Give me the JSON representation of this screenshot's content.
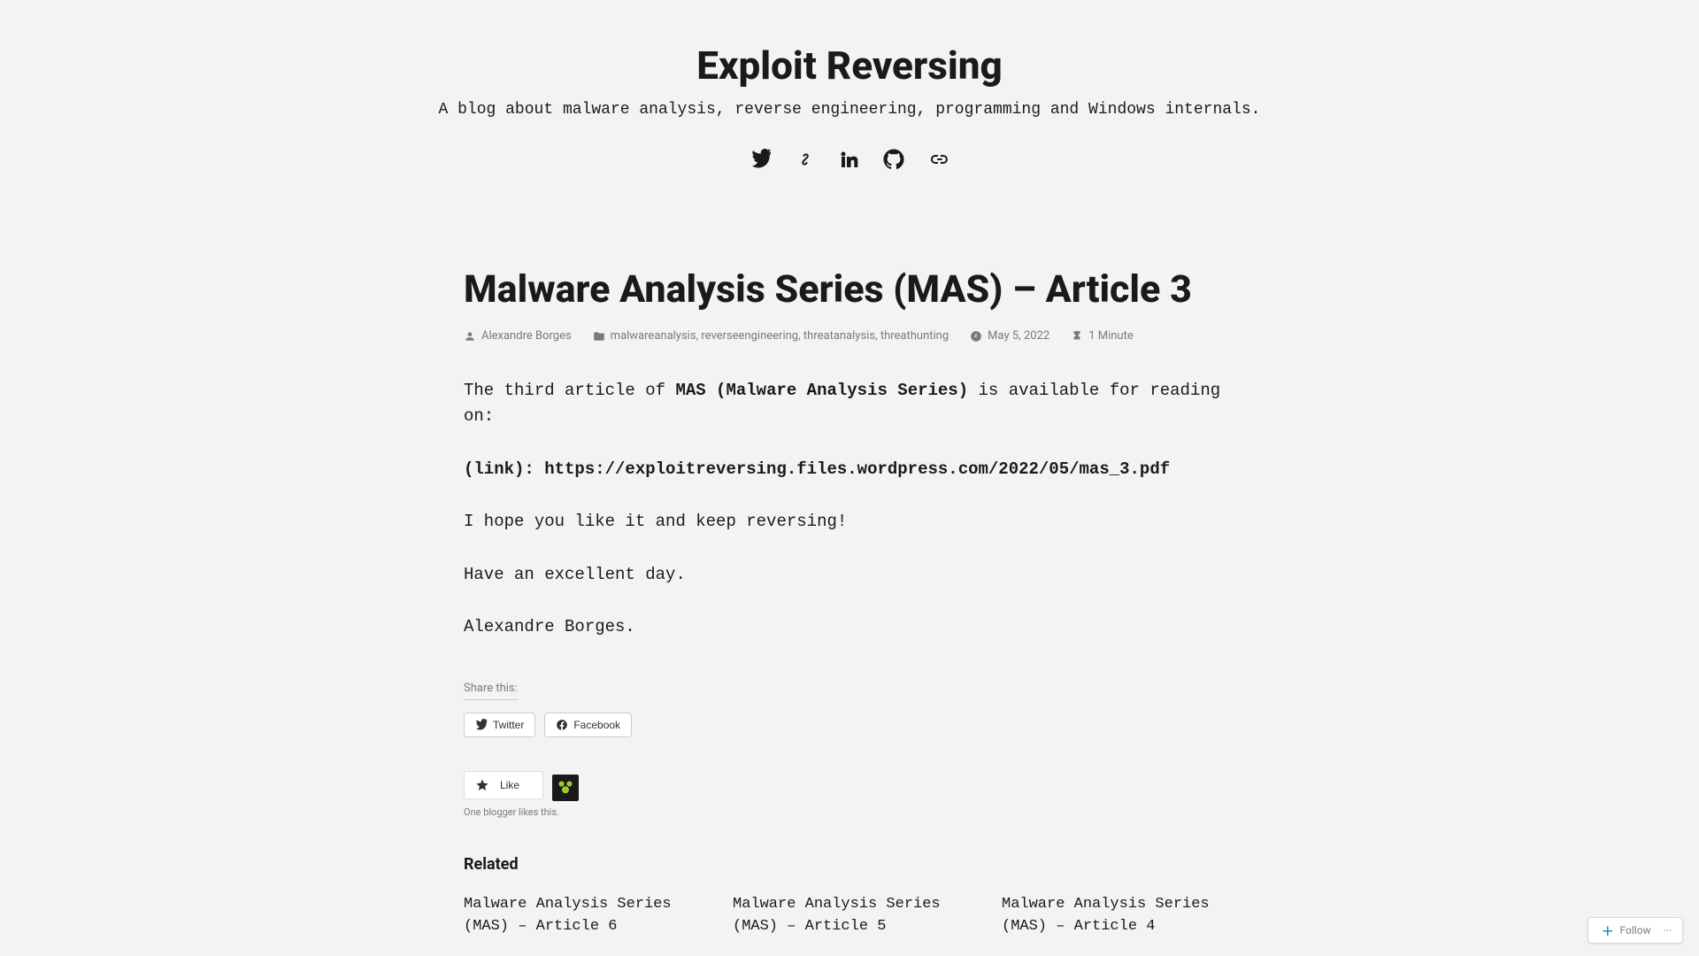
{
  "header": {
    "site_title": "Exploit Reversing",
    "tagline": "A blog about malware analysis, reverse engineering, programming and Windows internals.",
    "social": {
      "twitter": "twitter-icon",
      "link": "link-icon",
      "linkedin": "linkedin-icon",
      "github": "github-icon",
      "chain": "chain-icon"
    }
  },
  "article": {
    "title": "Malware Analysis Series (MAS) – Article 3",
    "meta": {
      "author": "Alexandre Borges",
      "tags": [
        "malwareanalysis",
        "reverseengineering",
        "threatanalysis",
        "threathunting"
      ],
      "date": "May 5, 2022",
      "read_time": "1 Minute"
    },
    "body": {
      "p1_prefix": "The third article of ",
      "p1_strong": "MAS (Malware Analysis Series)",
      "p1_suffix": " is available for reading on:",
      "p2_prefix": "(link): ",
      "p2_link": "https://exploitreversing.files.wordpress.com/2022/05/mas_3.pdf",
      "p3": "I hope you like it and keep reversing!",
      "p4": "Have an excellent day.",
      "p5": "Alexandre Borges."
    }
  },
  "share": {
    "label": "Share this:",
    "twitter": "Twitter",
    "facebook": "Facebook"
  },
  "likes": {
    "like_label": "Like",
    "caption": "One blogger likes this."
  },
  "related": {
    "heading": "Related",
    "items": [
      {
        "title": "Malware Analysis Series (MAS) – Article 6"
      },
      {
        "title": "Malware Analysis Series (MAS) – Article 5"
      },
      {
        "title": "Malware Analysis Series (MAS) – Article 4"
      }
    ]
  },
  "follow": {
    "label": "Follow"
  }
}
